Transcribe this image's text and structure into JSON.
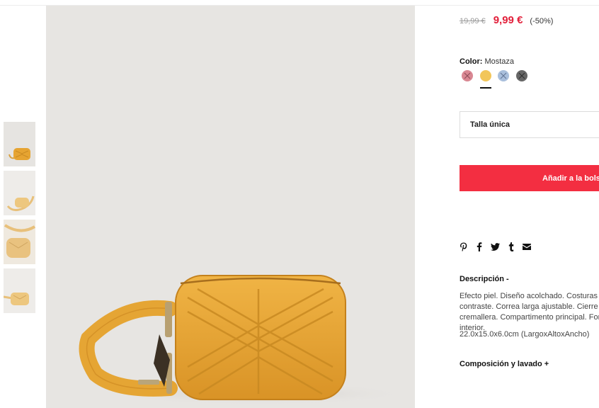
{
  "product": {
    "old_price": "19,99 €",
    "new_price": "9,99 €",
    "discount": "(-50%)"
  },
  "color": {
    "label": "Color:",
    "value": "Mostaza",
    "swatches": [
      {
        "name": "swatch-rosa",
        "color": "#d98792",
        "available": false
      },
      {
        "name": "swatch-mostaza",
        "color": "#f2c65a",
        "available": true,
        "selected": true
      },
      {
        "name": "swatch-azul",
        "color": "#a9bfdc",
        "available": false
      },
      {
        "name": "swatch-gris",
        "color": "#666666",
        "available": false
      }
    ]
  },
  "size": {
    "label": "Talla única"
  },
  "cart": {
    "button_label": "Añadir a la bolsa"
  },
  "share": {
    "icons": [
      "pinterest-icon",
      "facebook-icon",
      "twitter-icon",
      "tumblr-icon",
      "mail-icon"
    ]
  },
  "description": {
    "title": "Descripción  -",
    "text": "Efecto piel. Diseño acolchado. Costuras en contraste. Correa larga ajustable. Cierre de cremallera. Compartimento principal. Forro interior.",
    "dimensions": "22.0x15.0x6.0cm (LargoxAltoxAncho)"
  },
  "composition": {
    "title": "Composición y lavado  +"
  },
  "colors": {
    "accent": "#f32e41",
    "price_red": "#e21f3a",
    "bag": "#e8a93a",
    "background": "#e7e5e2"
  }
}
